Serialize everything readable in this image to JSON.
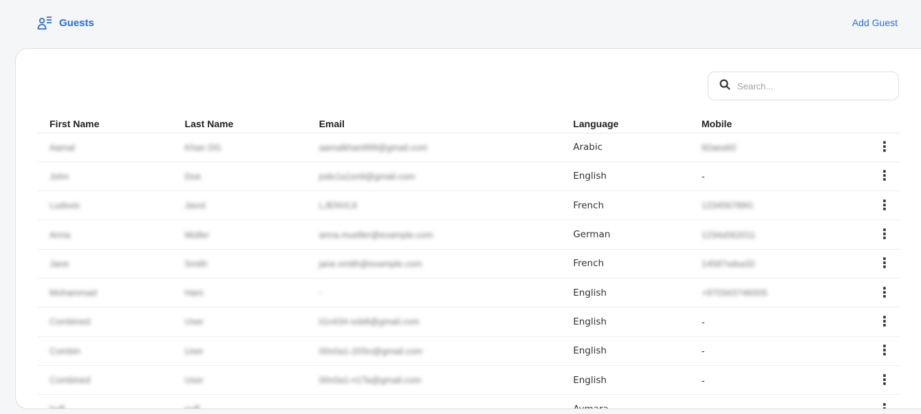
{
  "header": {
    "title": "Guests",
    "add_button": "Add Guest",
    "accent": "#2a6fdb"
  },
  "search": {
    "placeholder": "Search..."
  },
  "table": {
    "columns": [
      "First Name",
      "Last Name",
      "Email",
      "Language",
      "Mobile"
    ],
    "rows": [
      {
        "first": "Aamal",
        "last": "Khan DG",
        "email": "aamalkhan999@gmail.com",
        "language": "Arabic",
        "mobile": "92aea92"
      },
      {
        "first": "John",
        "last": "Doe",
        "email": "jodo1a1sn9@gmail.com",
        "language": "English",
        "mobile": "-"
      },
      {
        "first": "Ludovic",
        "last": "Javol",
        "email": "LJENVL9",
        "language": "French",
        "mobile": "123456789G"
      },
      {
        "first": "Anna",
        "last": "Müller",
        "email": "anna.mueller@example.com",
        "language": "German",
        "mobile": "1234a562011"
      },
      {
        "first": "Jane",
        "last": "Smith",
        "email": "jane.smith@example.com",
        "language": "French",
        "mobile": "14587sdsa32"
      },
      {
        "first": "Mohammad",
        "last": "Hani",
        "email": "-",
        "language": "English",
        "mobile": "+97034374600S"
      },
      {
        "first": "Combined",
        "last": "User",
        "email": "ii1n434-ssb8@gmail.com",
        "language": "English",
        "mobile": "-"
      },
      {
        "first": "Combin",
        "last": "User",
        "email": "00n0a1-20Sn@gmail.com",
        "language": "English",
        "mobile": "-"
      },
      {
        "first": "Combined",
        "last": "User",
        "email": "00n0a1-n1Ta@gmail.com",
        "language": "English",
        "mobile": "-"
      },
      {
        "first": "huff",
        "last": "puff",
        "email": "",
        "language": "Aymara",
        "mobile": ""
      }
    ]
  }
}
